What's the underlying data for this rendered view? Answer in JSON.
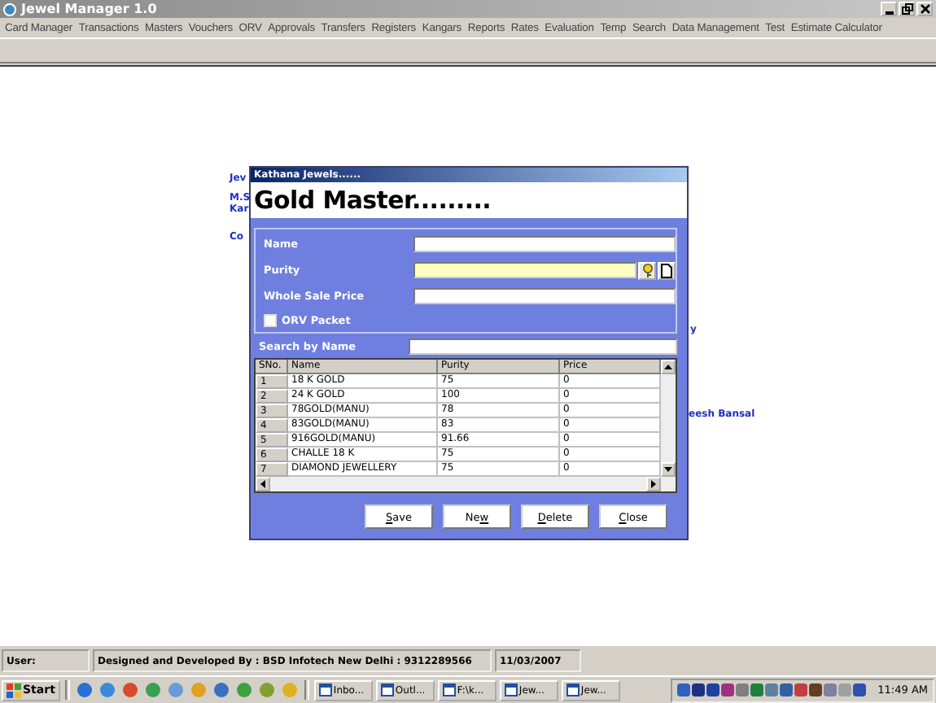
{
  "window": {
    "title": "Jewel Manager 1.0"
  },
  "menu": [
    "Card Manager",
    "Transactions",
    "Masters",
    "Vouchers",
    "ORV",
    "Approvals",
    "Transfers",
    "Registers",
    "Kangars",
    "Reports",
    "Rates",
    "Evaluation",
    "Temp",
    "Search",
    "Data Management",
    "Test",
    "Estimate Calculator"
  ],
  "background_text": {
    "left": [
      "Jev",
      "M.S",
      "Kar",
      "Co"
    ],
    "right": [
      "y",
      "eesh Bansal"
    ]
  },
  "dialog": {
    "title": "Kathana Jewels......",
    "heading": "Gold Master.........",
    "fields": [
      {
        "label": "Name",
        "kind": "text"
      },
      {
        "label": "Purity",
        "kind": "lookup"
      },
      {
        "label": "Whole Sale Price",
        "kind": "text"
      }
    ],
    "checkbox": {
      "label": "ORV Packet",
      "checked": false
    },
    "search": {
      "label": "Search by  Name"
    },
    "table": {
      "columns": [
        "SNo.",
        "Name",
        "Purity",
        "Price"
      ],
      "rows": [
        [
          "1",
          "18 K GOLD",
          "75",
          "0"
        ],
        [
          "2",
          "24 K GOLD",
          "100",
          "0"
        ],
        [
          "3",
          "78GOLD(MANU)",
          "78",
          "0"
        ],
        [
          "4",
          "83GOLD(MANU)",
          "83",
          "0"
        ],
        [
          "5",
          "916GOLD(MANU)",
          "91.66",
          "0"
        ],
        [
          "6",
          "CHALLE 18 K",
          "75",
          "0"
        ],
        [
          "7",
          "DIAMOND JEWELLERY",
          "75",
          "0"
        ]
      ]
    },
    "buttons": [
      {
        "label": "Save"
      },
      {
        "label": "New"
      },
      {
        "label": "Delete"
      },
      {
        "label": "Close"
      }
    ]
  },
  "status_bar": {
    "user": "User:",
    "credit": "Designed and Developed By : BSD Infotech New Delhi : 9312289566",
    "date": "11/03/2007"
  },
  "taskbar": {
    "start": "Start",
    "tasks": [
      "Inbo...",
      "Outl...",
      "F:\\k...",
      "Jew...",
      "Jew..."
    ],
    "clock": "11:49 AM"
  }
}
